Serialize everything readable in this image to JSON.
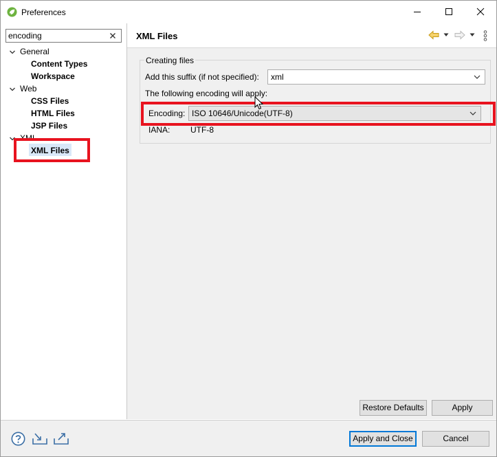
{
  "window": {
    "title": "Preferences"
  },
  "left": {
    "search_value": "encoding",
    "tree": [
      {
        "label": "General",
        "children": [
          "Content Types",
          "Workspace"
        ]
      },
      {
        "label": "Web",
        "children": [
          "CSS Files",
          "HTML Files",
          "JSP Files"
        ]
      },
      {
        "label": "XML",
        "children": [
          "XML Files"
        ]
      }
    ],
    "selected": "XML Files"
  },
  "page": {
    "title": "XML Files",
    "group_label": "Creating files",
    "suffix_label": "Add this suffix (if not specified):",
    "suffix_value": "xml",
    "apply_note": "The following encoding will apply:",
    "encoding_label": "Encoding:",
    "encoding_value": "ISO 10646/Unicode(UTF-8)",
    "iana_label": "IANA:",
    "iana_value": "UTF-8",
    "restore_defaults": "Restore Defaults",
    "apply": "Apply"
  },
  "footer": {
    "apply_close": "Apply and Close",
    "cancel": "Cancel"
  },
  "colors": {
    "highlight_box": "#e8131f",
    "selection": "#d9e8f8",
    "primary_border": "#0078d7"
  }
}
